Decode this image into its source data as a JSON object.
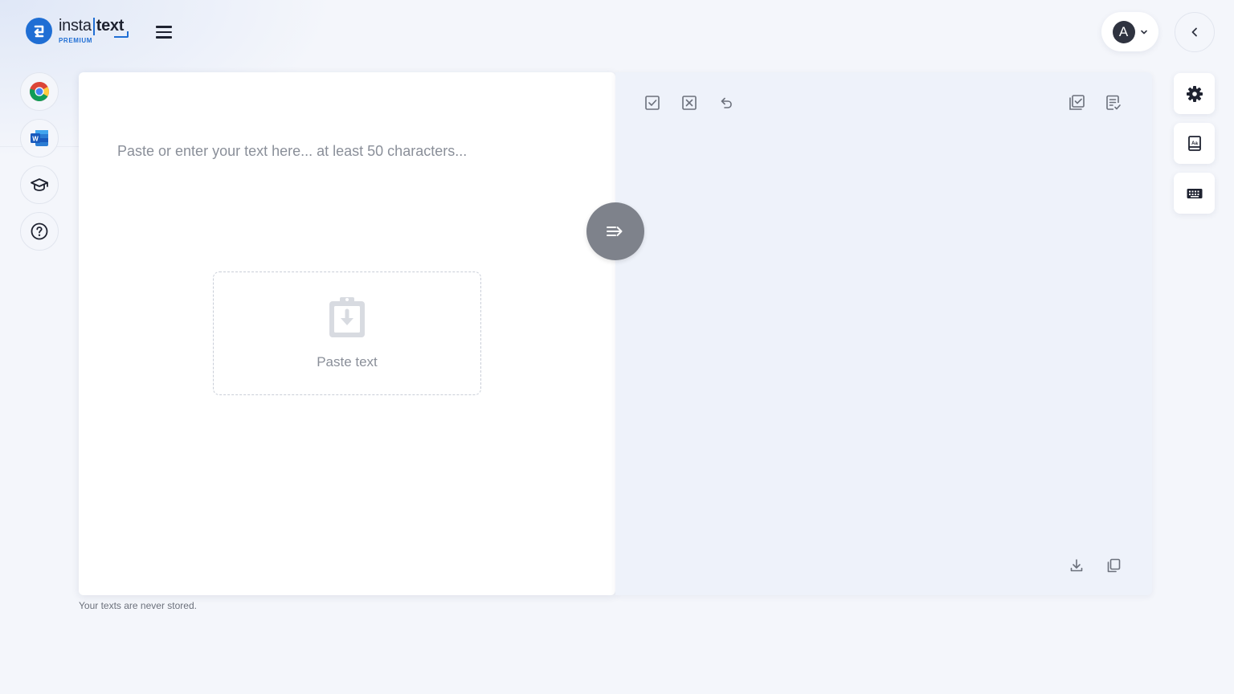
{
  "header": {
    "logo_word_1": "insta",
    "logo_word_2": "text",
    "logo_badge": "PREMIUM",
    "avatar_initial": "A"
  },
  "sidebar": {
    "items": [
      {
        "name": "chrome-extension",
        "icon": "chrome-icon"
      },
      {
        "name": "word-addin",
        "icon": "word-icon"
      },
      {
        "name": "academy",
        "icon": "graduation-cap-icon"
      },
      {
        "name": "help",
        "icon": "help-circle-icon"
      }
    ]
  },
  "input": {
    "placeholder": "Paste or enter your text here... at least 50 characters...",
    "value": "",
    "paste_label": "Paste text"
  },
  "footer": {
    "privacy_note": "Your texts are never stored."
  },
  "output": {
    "toolbar": [
      "accept-all-icon",
      "reject-all-icon",
      "undo-icon",
      "check-document-icon",
      "notes-icon"
    ],
    "bottom_tools": [
      "download-icon",
      "copy-icon"
    ]
  },
  "right_rail": [
    "settings-icon",
    "dictionary-icon",
    "keyboard-icon"
  ],
  "colors": {
    "brand": "#1f6ed4",
    "background": "#f4f6fb",
    "output_bg": "#eef2fa",
    "convert_button": "#7e828b"
  }
}
